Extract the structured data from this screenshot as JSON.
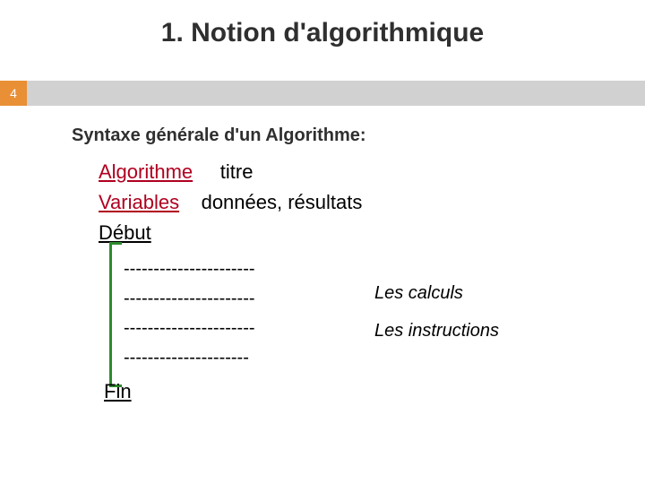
{
  "page_number": "4",
  "title": "1. Notion d'algorithmique",
  "subtitle": "Syntaxe générale d'un Algorithme:",
  "algo": {
    "kw_algorithme": "Algorithme",
    "title_word": "titre",
    "kw_variables": "Variables",
    "vars_text": "données, résultats",
    "kw_debut": "Début",
    "dash_lines": [
      "----------------------",
      "----------------------",
      "----------------------",
      "---------------------"
    ],
    "kw_fin": "Fin"
  },
  "side_notes": {
    "calculs": "Les calculs",
    "instructions": "Les instructions"
  }
}
